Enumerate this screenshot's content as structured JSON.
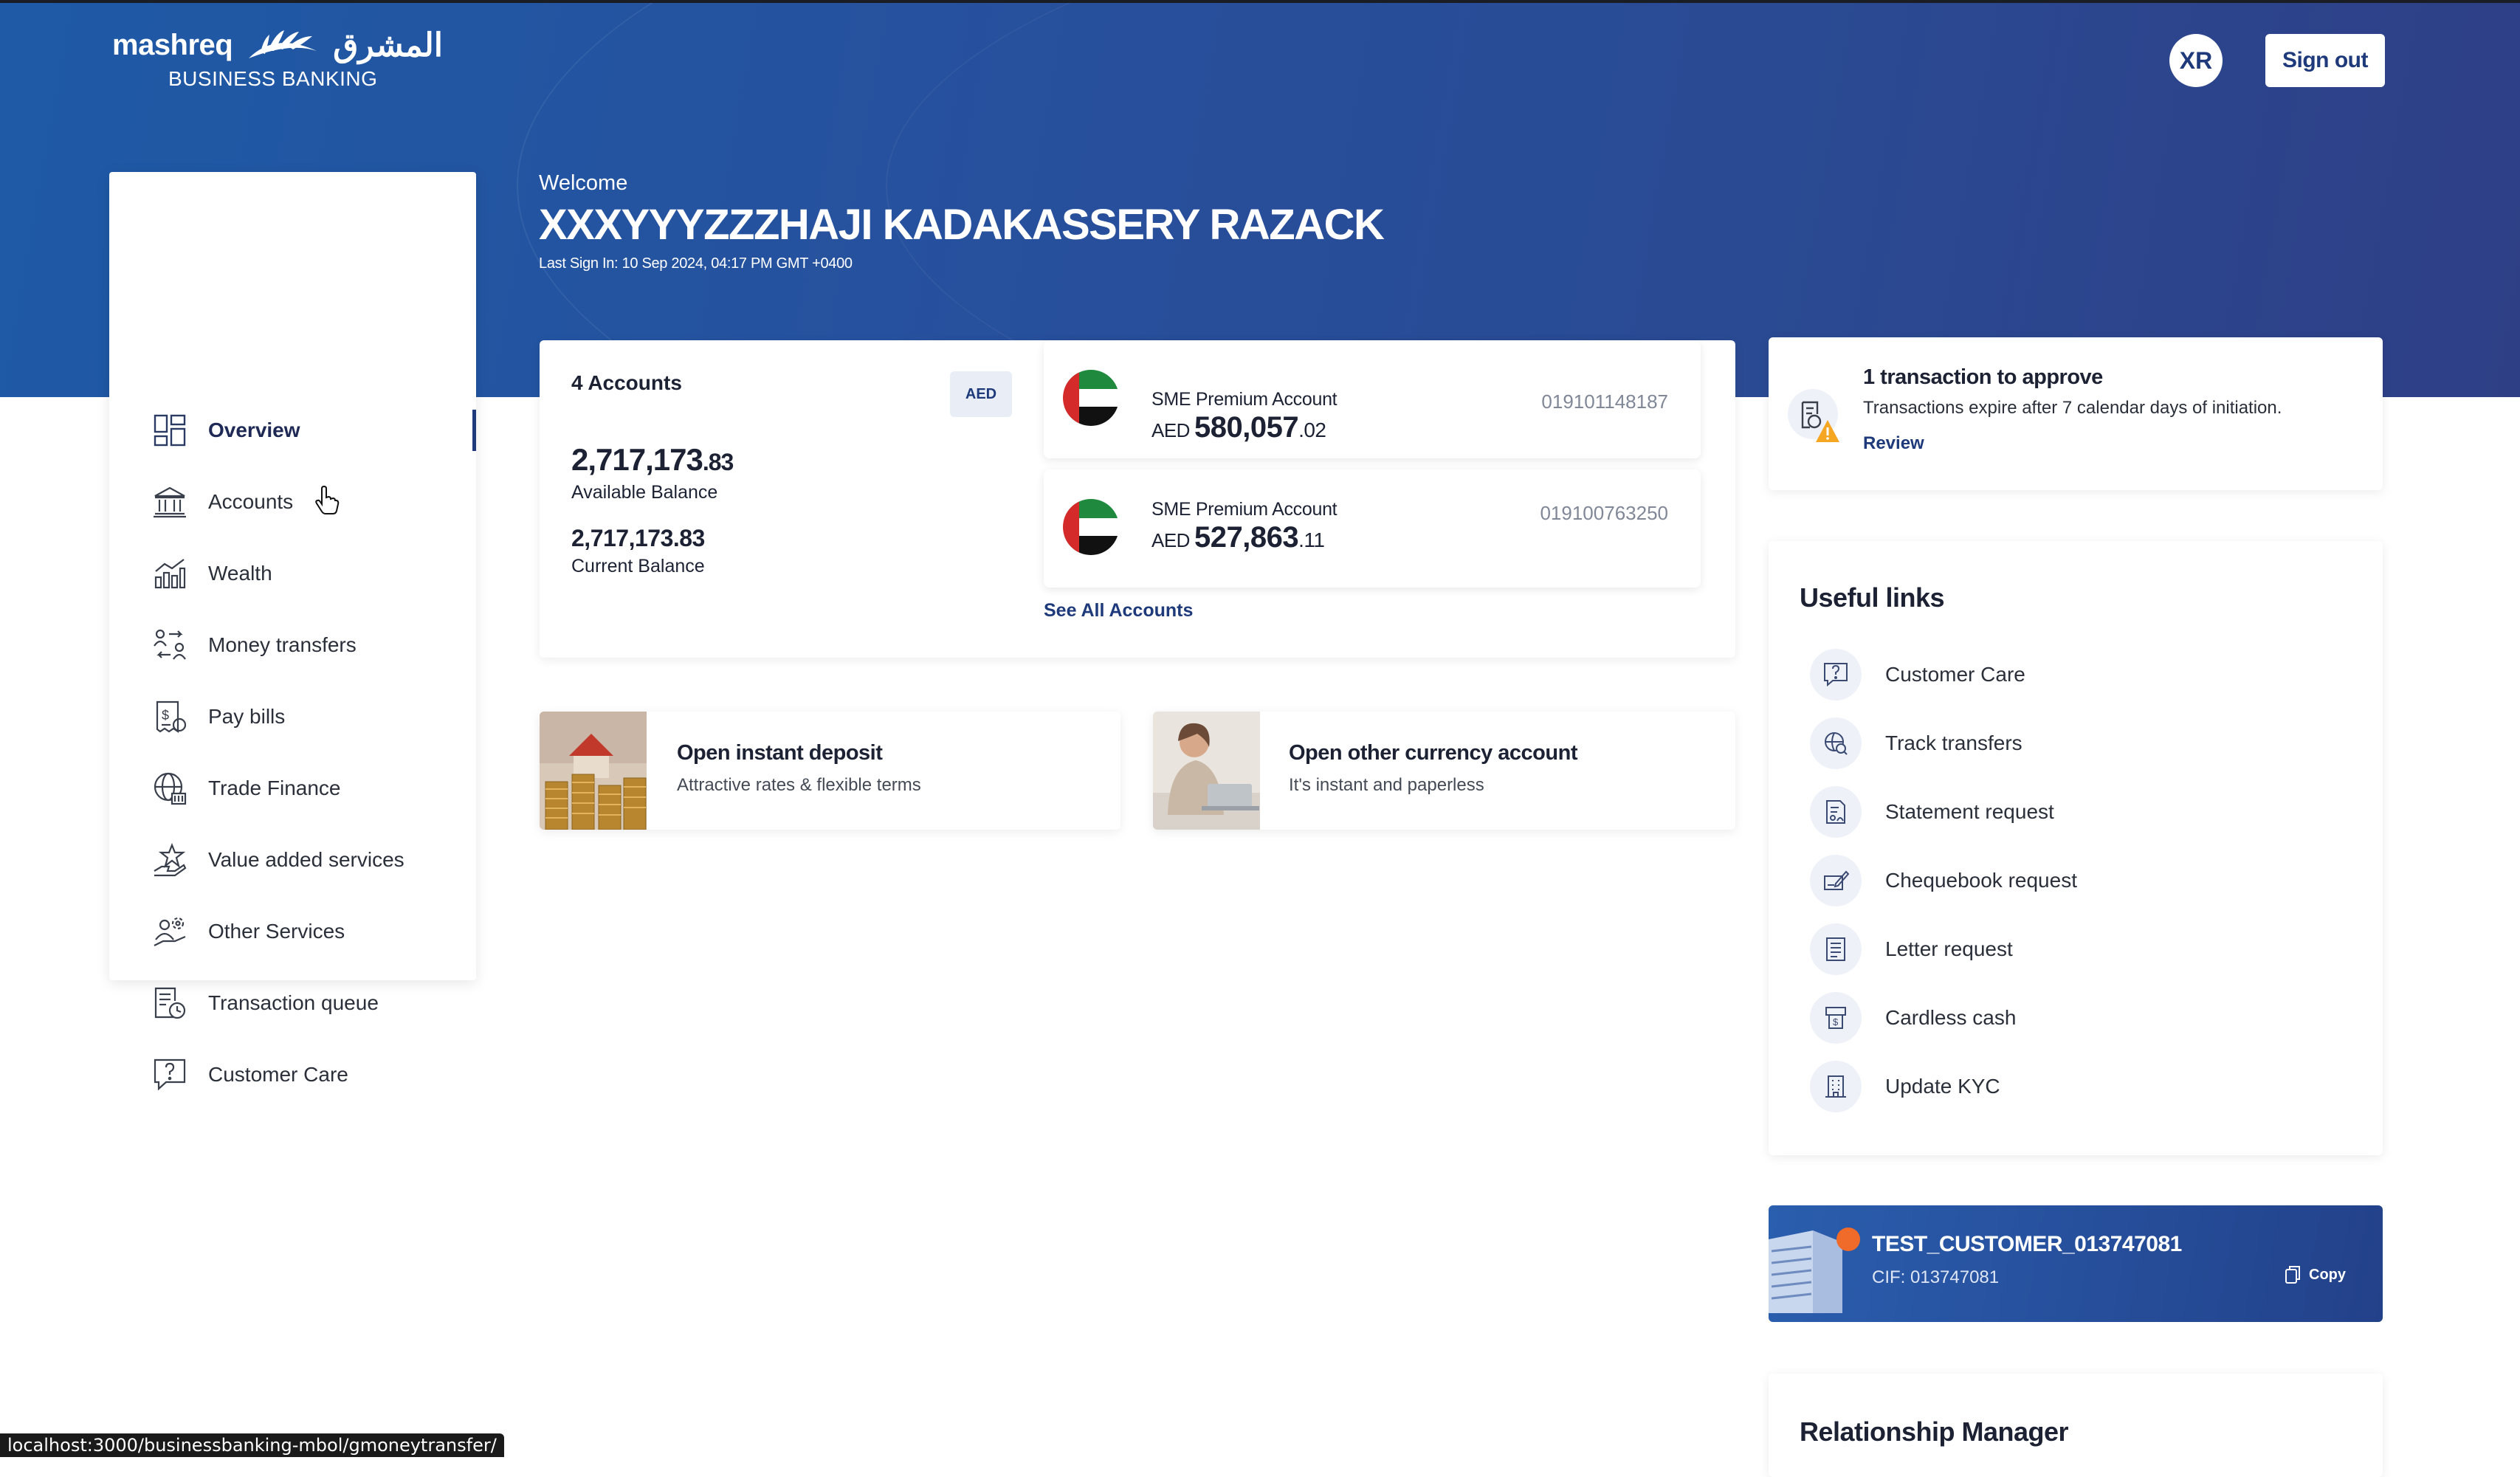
{
  "header": {
    "logo_en": "mashreq",
    "logo_ar": "المشرق",
    "logo_sub": "BUSINESS BANKING",
    "avatar_initials": "XR",
    "sign_out": "Sign out"
  },
  "welcome": {
    "greeting": "Welcome",
    "name": "XXXYYYZZZHAJI KADAKASSERY RAZACK",
    "last_sign_in": "Last Sign In: 10 Sep 2024, 04:17 PM GMT +0400"
  },
  "sidebar": {
    "items": [
      {
        "label": "Overview",
        "icon": "overview-icon",
        "active": true
      },
      {
        "label": "Accounts",
        "icon": "bank-icon"
      },
      {
        "label": "Wealth",
        "icon": "chart-icon"
      },
      {
        "label": "Money transfers",
        "icon": "transfer-icon"
      },
      {
        "label": "Pay bills",
        "icon": "bill-icon"
      },
      {
        "label": "Trade Finance",
        "icon": "globe-icon"
      },
      {
        "label": "Value added services",
        "icon": "star-hand-icon"
      },
      {
        "label": "Other Services",
        "icon": "services-icon"
      },
      {
        "label": "Transaction queue",
        "icon": "queue-icon"
      },
      {
        "label": "Customer Care",
        "icon": "help-icon"
      }
    ]
  },
  "accounts": {
    "count_label": "4 Accounts",
    "currency_badge": "AED",
    "available_main": "2,717,173",
    "available_dec": ".83",
    "available_label": "Available Balance",
    "current_value": "2,717,173.83",
    "current_label": "Current Balance",
    "see_all": "See All Accounts",
    "list": [
      {
        "type": "SME Premium Account",
        "currency": "AED",
        "amount_main": "580,057",
        "amount_dec": ".02",
        "number": "019101148187"
      },
      {
        "type": "SME Premium Account",
        "currency": "AED",
        "amount_main": "527,863",
        "amount_dec": ".11",
        "number": "019100763250"
      }
    ]
  },
  "promos": [
    {
      "title": "Open instant deposit",
      "subtitle": "Attractive rates & flexible terms"
    },
    {
      "title": "Open other currency account",
      "subtitle": "It's instant and paperless"
    }
  ],
  "approval": {
    "title": "1 transaction to approve",
    "subtitle": "Transactions expire after 7 calendar days of initiation.",
    "action": "Review"
  },
  "useful_links": {
    "heading": "Useful links",
    "items": [
      {
        "label": "Customer Care",
        "icon": "help-icon"
      },
      {
        "label": "Track transfers",
        "icon": "track-icon"
      },
      {
        "label": "Statement request",
        "icon": "statement-icon"
      },
      {
        "label": "Chequebook request",
        "icon": "chequebook-icon"
      },
      {
        "label": "Letter request",
        "icon": "letter-icon"
      },
      {
        "label": "Cardless cash",
        "icon": "atm-icon"
      },
      {
        "label": "Update KYC",
        "icon": "building-icon"
      }
    ]
  },
  "customer": {
    "name": "TEST_CUSTOMER_013747081",
    "cif": "CIF: 013747081",
    "copy": "Copy"
  },
  "relationship_manager": {
    "heading": "Relationship Manager"
  },
  "status_url": "localhost:3000/businessbanking-mbol/gmoneytransfer/",
  "colors": {
    "brand_dark": "#1e3a7a",
    "hero": "#27509d",
    "accent_orange": "#f06a2a"
  }
}
